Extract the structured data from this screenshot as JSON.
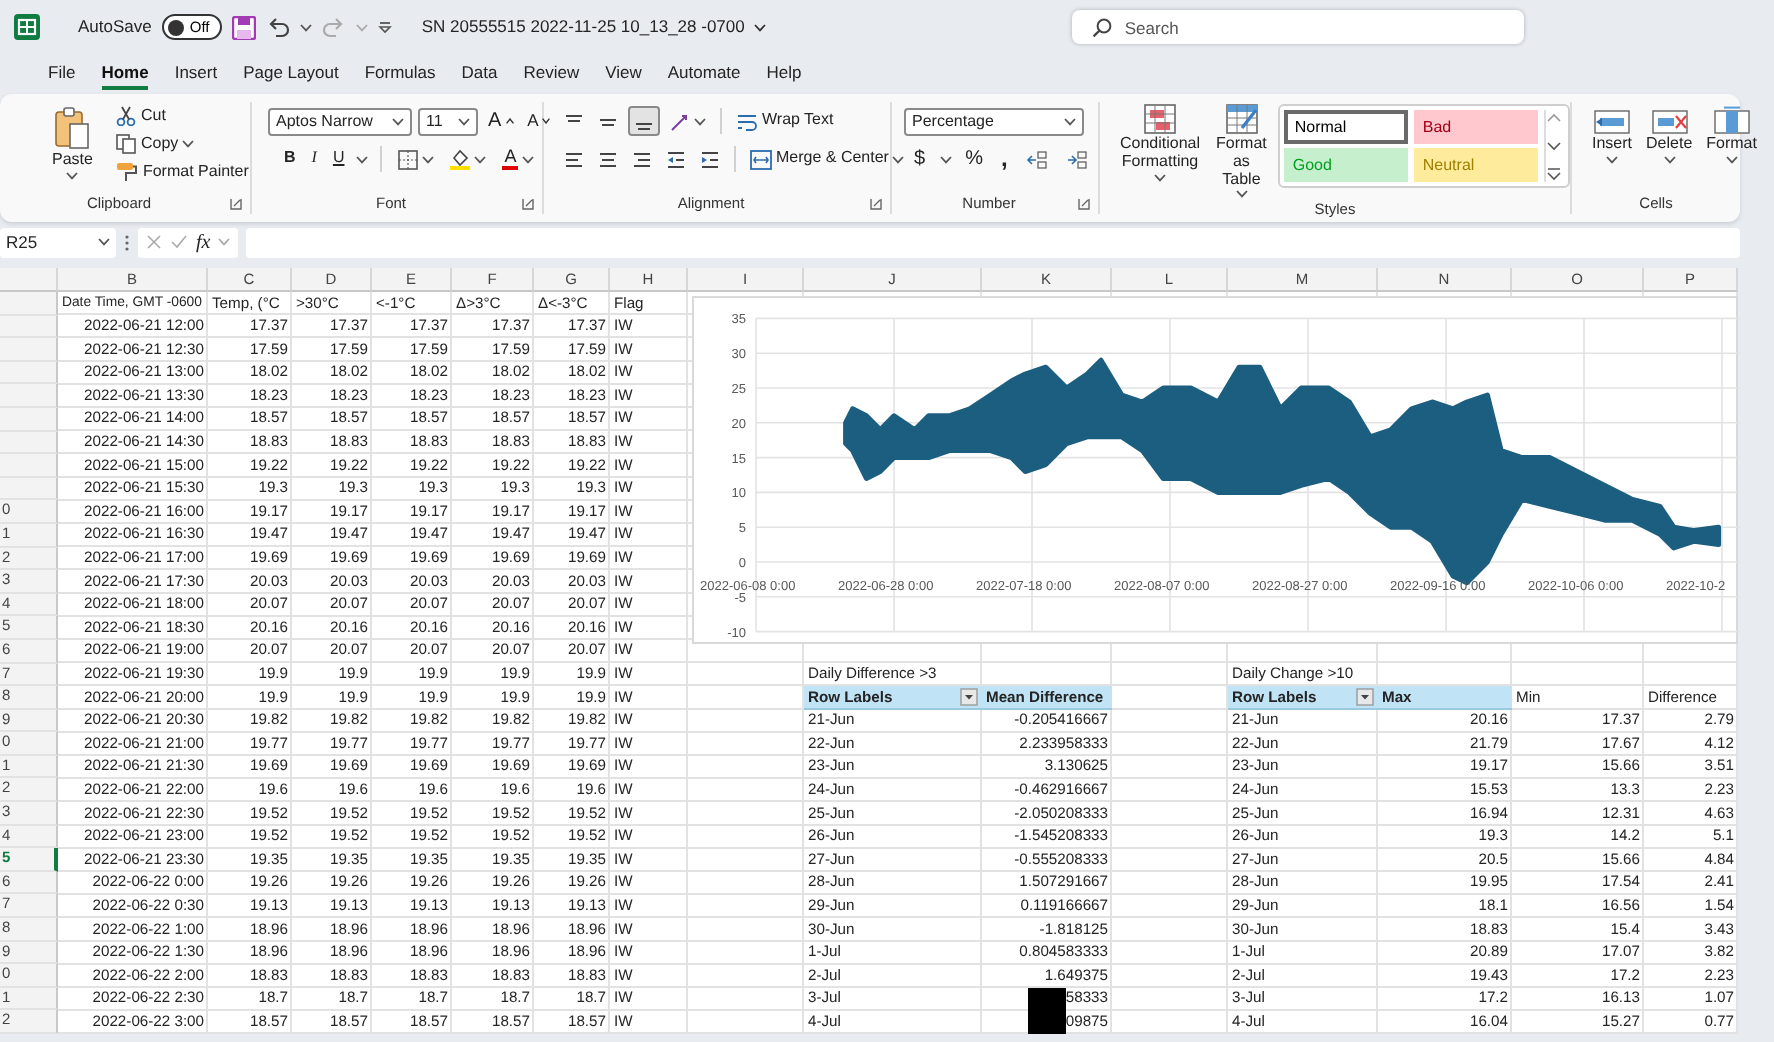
{
  "title_bar": {
    "autosave_label": "AutoSave",
    "autosave": {
      "on": false,
      "label": "Off"
    },
    "title": "SN 20555515 2022-11-25 10_13_28 -0700",
    "search": {
      "placeholder": "Search"
    }
  },
  "tabs": [
    {
      "label": "File",
      "selected": false
    },
    {
      "label": "Home",
      "selected": true
    },
    {
      "label": "Insert",
      "selected": false
    },
    {
      "label": "Page Layout",
      "selected": false
    },
    {
      "label": "Formulas",
      "selected": false
    },
    {
      "label": "Data",
      "selected": false
    },
    {
      "label": "Review",
      "selected": false
    },
    {
      "label": "View",
      "selected": false
    },
    {
      "label": "Automate",
      "selected": false
    },
    {
      "label": "Help",
      "selected": false
    }
  ],
  "ribbon_groups": [
    {
      "kind": "clipboard",
      "label": "Clipboard",
      "launcher": true,
      "paste": "Paste",
      "cut": "Cut",
      "copy": "Copy",
      "format_painter": "Format Painter"
    },
    {
      "kind": "font",
      "label": "Font",
      "launcher": true,
      "font_name": "Aptos Narrow",
      "font_size": "11",
      "grow": "A",
      "shrink": "A",
      "bold": "B",
      "italic": "I",
      "underline": "U",
      "font_color": "A"
    },
    {
      "kind": "alignment",
      "label": "Alignment",
      "launcher": true,
      "vertical_align": [
        {
          "selected": false
        },
        {
          "selected": false
        },
        {
          "selected": true
        }
      ],
      "wrap_text": "Wrap Text",
      "merge_center": "Merge & Center"
    },
    {
      "kind": "number",
      "label": "Number",
      "launcher": true,
      "format": "Percentage",
      "currency": "$",
      "percent": "%",
      "comma": ","
    },
    {
      "kind": "styles",
      "label": "Styles",
      "launcher": false,
      "conditional_formatting": "Conditional Formatting",
      "format_as_table": "Format as Table",
      "gallery": [
        {
          "label": "Normal",
          "color": "#ffffff",
          "selected": true
        },
        {
          "label": "Bad",
          "color": "#ffc7ce",
          "selected": false
        },
        {
          "label": "Good",
          "color": "#c6efce",
          "selected": false
        },
        {
          "label": "Neutral",
          "color": "#ffeb9c",
          "selected": false
        }
      ]
    },
    {
      "kind": "cells",
      "label": "Cells",
      "launcher": false,
      "buttons": [
        "Insert",
        "Delete",
        "Format"
      ]
    }
  ],
  "formula_bar": {
    "name_box": "R25",
    "function_label": "fx"
  },
  "sheet": {
    "columns": [
      "B",
      "C",
      "D",
      "E",
      "F",
      "G",
      "H",
      "I",
      "J",
      "K",
      "L",
      "M",
      "N",
      "O",
      "P"
    ],
    "rows": [
      {
        "kind": "header",
        "selected": false,
        "cells": [
          "Date Time, GMT -0600",
          "Temp, (°C",
          ">30°C",
          "<-1°C",
          "Δ>3°C",
          "Δ<-3°C",
          "Flag"
        ]
      },
      {
        "kind": "data",
        "selected": false,
        "cells": [
          "2022-06-21 12:00",
          "17.37",
          "17.37",
          "17.37",
          "17.37",
          "17.37",
          "IW"
        ]
      },
      {
        "kind": "data",
        "selected": false,
        "cells": [
          "2022-06-21 12:30",
          "17.59",
          "17.59",
          "17.59",
          "17.59",
          "17.59",
          "IW"
        ]
      },
      {
        "kind": "data",
        "selected": false,
        "cells": [
          "2022-06-21 13:00",
          "18.02",
          "18.02",
          "18.02",
          "18.02",
          "18.02",
          "IW"
        ]
      },
      {
        "kind": "data",
        "selected": false,
        "cells": [
          "2022-06-21 13:30",
          "18.23",
          "18.23",
          "18.23",
          "18.23",
          "18.23",
          "IW"
        ]
      },
      {
        "kind": "data",
        "selected": false,
        "cells": [
          "2022-06-21 14:00",
          "18.57",
          "18.57",
          "18.57",
          "18.57",
          "18.57",
          "IW"
        ]
      },
      {
        "kind": "data",
        "selected": false,
        "cells": [
          "2022-06-21 14:30",
          "18.83",
          "18.83",
          "18.83",
          "18.83",
          "18.83",
          "IW"
        ]
      },
      {
        "kind": "data",
        "selected": false,
        "cells": [
          "2022-06-21 15:00",
          "19.22",
          "19.22",
          "19.22",
          "19.22",
          "19.22",
          "IW"
        ]
      },
      {
        "kind": "data",
        "selected": false,
        "cells": [
          "2022-06-21 15:30",
          "19.3",
          "19.3",
          "19.3",
          "19.3",
          "19.3",
          "IW"
        ]
      },
      {
        "kind": "data",
        "header": "0",
        "selected": false,
        "cells": [
          "2022-06-21 16:00",
          "19.17",
          "19.17",
          "19.17",
          "19.17",
          "19.17",
          "IW"
        ]
      },
      {
        "kind": "data",
        "header": "1",
        "selected": false,
        "cells": [
          "2022-06-21 16:30",
          "19.47",
          "19.47",
          "19.47",
          "19.47",
          "19.47",
          "IW"
        ]
      },
      {
        "kind": "data",
        "header": "2",
        "selected": false,
        "cells": [
          "2022-06-21 17:00",
          "19.69",
          "19.69",
          "19.69",
          "19.69",
          "19.69",
          "IW"
        ]
      },
      {
        "kind": "data",
        "header": "3",
        "selected": false,
        "cells": [
          "2022-06-21 17:30",
          "20.03",
          "20.03",
          "20.03",
          "20.03",
          "20.03",
          "IW"
        ]
      },
      {
        "kind": "data",
        "header": "4",
        "selected": false,
        "cells": [
          "2022-06-21 18:00",
          "20.07",
          "20.07",
          "20.07",
          "20.07",
          "20.07",
          "IW"
        ]
      },
      {
        "kind": "data",
        "header": "5",
        "selected": false,
        "cells": [
          "2022-06-21 18:30",
          "20.16",
          "20.16",
          "20.16",
          "20.16",
          "20.16",
          "IW"
        ]
      },
      {
        "kind": "data",
        "header": "6",
        "selected": false,
        "cells": [
          "2022-06-21 19:00",
          "20.07",
          "20.07",
          "20.07",
          "20.07",
          "20.07",
          "IW"
        ]
      },
      {
        "kind": "data",
        "header": "7",
        "selected": false,
        "cells": [
          "2022-06-21 19:30",
          "19.9",
          "19.9",
          "19.9",
          "19.9",
          "19.9",
          "IW"
        ]
      },
      {
        "kind": "data",
        "header": "8",
        "selected": false,
        "cells": [
          "2022-06-21 20:00",
          "19.9",
          "19.9",
          "19.9",
          "19.9",
          "19.9",
          "IW"
        ]
      },
      {
        "kind": "data",
        "header": "9",
        "selected": false,
        "cells": [
          "2022-06-21 20:30",
          "19.82",
          "19.82",
          "19.82",
          "19.82",
          "19.82",
          "IW"
        ]
      },
      {
        "kind": "data",
        "header": "0",
        "selected": false,
        "cells": [
          "2022-06-21 21:00",
          "19.77",
          "19.77",
          "19.77",
          "19.77",
          "19.77",
          "IW"
        ]
      },
      {
        "kind": "data",
        "header": "1",
        "selected": false,
        "cells": [
          "2022-06-21 21:30",
          "19.69",
          "19.69",
          "19.69",
          "19.69",
          "19.69",
          "IW"
        ]
      },
      {
        "kind": "data",
        "header": "2",
        "selected": false,
        "cells": [
          "2022-06-21 22:00",
          "19.6",
          "19.6",
          "19.6",
          "19.6",
          "19.6",
          "IW"
        ]
      },
      {
        "kind": "data",
        "header": "3",
        "selected": false,
        "cells": [
          "2022-06-21 22:30",
          "19.52",
          "19.52",
          "19.52",
          "19.52",
          "19.52",
          "IW"
        ]
      },
      {
        "kind": "data",
        "header": "4",
        "selected": false,
        "cells": [
          "2022-06-21 23:00",
          "19.52",
          "19.52",
          "19.52",
          "19.52",
          "19.52",
          "IW"
        ]
      },
      {
        "kind": "data",
        "header": "5",
        "selected": true,
        "cells": [
          "2022-06-21 23:30",
          "19.35",
          "19.35",
          "19.35",
          "19.35",
          "19.35",
          "IW"
        ]
      },
      {
        "kind": "data",
        "header": "6",
        "selected": false,
        "cells": [
          "2022-06-22 0:00",
          "19.26",
          "19.26",
          "19.26",
          "19.26",
          "19.26",
          "IW"
        ]
      },
      {
        "kind": "data",
        "header": "7",
        "selected": false,
        "cells": [
          "2022-06-22 0:30",
          "19.13",
          "19.13",
          "19.13",
          "19.13",
          "19.13",
          "IW"
        ]
      },
      {
        "kind": "data",
        "header": "8",
        "selected": false,
        "cells": [
          "2022-06-22 1:00",
          "18.96",
          "18.96",
          "18.96",
          "18.96",
          "18.96",
          "IW"
        ]
      },
      {
        "kind": "data",
        "header": "9",
        "selected": false,
        "cells": [
          "2022-06-22 1:30",
          "18.96",
          "18.96",
          "18.96",
          "18.96",
          "18.96",
          "IW"
        ]
      },
      {
        "kind": "data",
        "header": "0",
        "selected": false,
        "cells": [
          "2022-06-22 2:00",
          "18.83",
          "18.83",
          "18.83",
          "18.83",
          "18.83",
          "IW"
        ]
      },
      {
        "kind": "data",
        "header": "1",
        "selected": false,
        "cells": [
          "2022-06-22 2:30",
          "18.7",
          "18.7",
          "18.7",
          "18.7",
          "18.7",
          "IW"
        ]
      },
      {
        "kind": "data",
        "header": "2",
        "selected": false,
        "cells": [
          "2022-06-22 3:00",
          "18.57",
          "18.57",
          "18.57",
          "18.57",
          "18.57",
          "IW"
        ]
      }
    ]
  },
  "chart": {
    "y_ticks": [
      "35",
      "30",
      "25",
      "20",
      "15",
      "10",
      "5",
      "0",
      "-5",
      "-10"
    ],
    "x_ticks": [
      "2022-06-08 0:00",
      "2022-06-28 0:00",
      "2022-07-18 0:00",
      "2022-08-07 0:00",
      "2022-08-27 0:00",
      "2022-09-16 0:00",
      "2022-10-06 0:00",
      "2022-10-2"
    ]
  },
  "pivot_tables": [
    {
      "title": "Daily Difference >3",
      "columns": [
        {
          "label": "Row Labels",
          "kind": "pivot",
          "filter": true
        },
        {
          "label": "Mean Difference",
          "kind": "pivot",
          "filter": false
        }
      ],
      "rows": [
        {
          "cells": [
            "21-Jun",
            "-0.205416667"
          ],
          "redacted": false
        },
        {
          "cells": [
            "22-Jun",
            "2.233958333"
          ],
          "redacted": false
        },
        {
          "cells": [
            "23-Jun",
            "3.130625"
          ],
          "redacted": false
        },
        {
          "cells": [
            "24-Jun",
            "-0.462916667"
          ],
          "redacted": false
        },
        {
          "cells": [
            "25-Jun",
            "-2.050208333"
          ],
          "redacted": false
        },
        {
          "cells": [
            "26-Jun",
            "-1.545208333"
          ],
          "redacted": false
        },
        {
          "cells": [
            "27-Jun",
            "-0.555208333"
          ],
          "redacted": false
        },
        {
          "cells": [
            "28-Jun",
            "1.507291667"
          ],
          "redacted": false
        },
        {
          "cells": [
            "29-Jun",
            "0.119166667"
          ],
          "redacted": false
        },
        {
          "cells": [
            "30-Jun",
            "-1.818125"
          ],
          "redacted": false
        },
        {
          "cells": [
            "1-Jul",
            "0.804583333"
          ],
          "redacted": false
        },
        {
          "cells": [
            "2-Jul",
            "1.649375"
          ],
          "redacted": false
        },
        {
          "cells": [
            "3-Jul",
            "58333"
          ],
          "redacted": true
        },
        {
          "cells": [
            "4-Jul",
            "09875"
          ],
          "redacted": true
        }
      ]
    },
    {
      "title": "Daily Change >10",
      "columns": [
        {
          "label": "Row Labels",
          "kind": "pivot",
          "filter": true
        },
        {
          "label": "Max",
          "kind": "pivot",
          "filter": false
        },
        {
          "label": "Min",
          "kind": "plain",
          "filter": false
        },
        {
          "label": "Difference",
          "kind": "plain",
          "filter": false
        }
      ],
      "rows": [
        {
          "cells": [
            "21-Jun",
            "20.16",
            "17.37",
            "2.79"
          ]
        },
        {
          "cells": [
            "22-Jun",
            "21.79",
            "17.67",
            "4.12"
          ]
        },
        {
          "cells": [
            "23-Jun",
            "19.17",
            "15.66",
            "3.51"
          ]
        },
        {
          "cells": [
            "24-Jun",
            "15.53",
            "13.3",
            "2.23"
          ]
        },
        {
          "cells": [
            "25-Jun",
            "16.94",
            "12.31",
            "4.63"
          ]
        },
        {
          "cells": [
            "26-Jun",
            "19.3",
            "14.2",
            "5.1"
          ]
        },
        {
          "cells": [
            "27-Jun",
            "20.5",
            "15.66",
            "4.84"
          ]
        },
        {
          "cells": [
            "28-Jun",
            "19.95",
            "17.54",
            "2.41"
          ]
        },
        {
          "cells": [
            "29-Jun",
            "18.1",
            "16.56",
            "1.54"
          ]
        },
        {
          "cells": [
            "30-Jun",
            "18.83",
            "15.4",
            "3.43"
          ]
        },
        {
          "cells": [
            "1-Jul",
            "20.89",
            "17.07",
            "3.82"
          ]
        },
        {
          "cells": [
            "2-Jul",
            "19.43",
            "17.2",
            "2.23"
          ]
        },
        {
          "cells": [
            "3-Jul",
            "17.2",
            "16.13",
            "1.07"
          ]
        },
        {
          "cells": [
            "4-Jul",
            "16.04",
            "15.27",
            "0.77"
          ]
        }
      ]
    }
  ]
}
